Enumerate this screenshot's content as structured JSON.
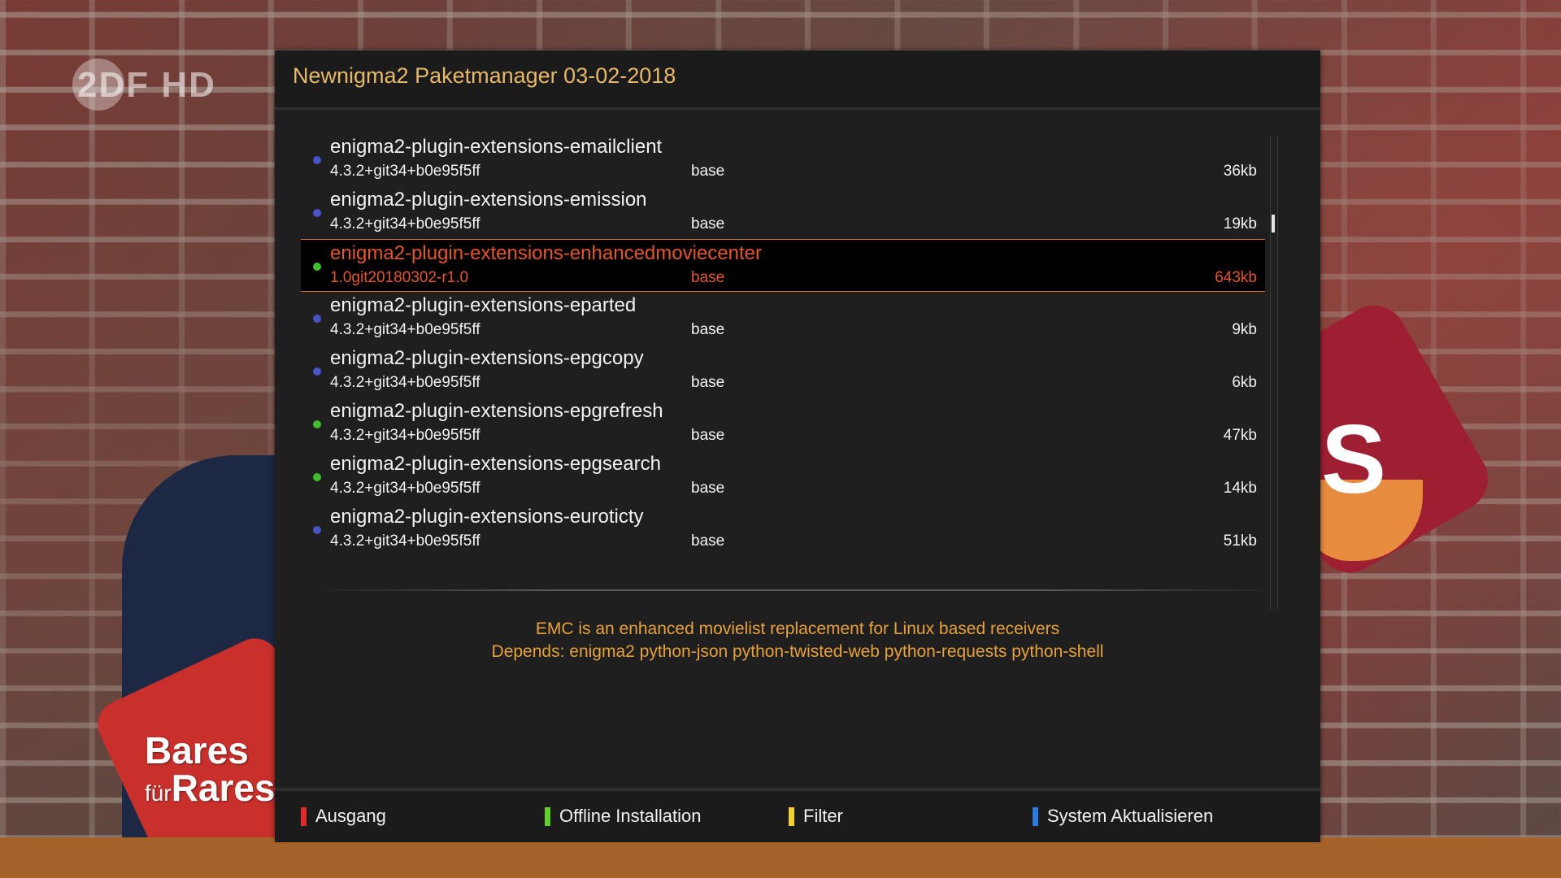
{
  "background": {
    "channel_logo": "2DF HD",
    "show_title_small": "für",
    "show_title_line1": "Bares",
    "show_title_line2": "Rares",
    "letter": "S"
  },
  "window": {
    "title": "Newnigma2 Paketmanager 03-02-2018"
  },
  "packages": [
    {
      "name": "enigma2-plugin-extensions-emailclient",
      "version": "4.3.2+git34+b0e95f5ff",
      "section": "base",
      "size": "36kb",
      "status": "blue",
      "selected": false
    },
    {
      "name": "enigma2-plugin-extensions-emission",
      "version": "4.3.2+git34+b0e95f5ff",
      "section": "base",
      "size": "19kb",
      "status": "blue",
      "selected": false
    },
    {
      "name": "enigma2-plugin-extensions-enhancedmoviecenter",
      "version": "1.0git20180302-r1.0",
      "section": "base",
      "size": "643kb",
      "status": "green",
      "selected": true
    },
    {
      "name": "enigma2-plugin-extensions-eparted",
      "version": "4.3.2+git34+b0e95f5ff",
      "section": "base",
      "size": "9kb",
      "status": "blue",
      "selected": false
    },
    {
      "name": "enigma2-plugin-extensions-epgcopy",
      "version": "4.3.2+git34+b0e95f5ff",
      "section": "base",
      "size": "6kb",
      "status": "blue",
      "selected": false
    },
    {
      "name": "enigma2-plugin-extensions-epgrefresh",
      "version": "4.3.2+git34+b0e95f5ff",
      "section": "base",
      "size": "47kb",
      "status": "green",
      "selected": false
    },
    {
      "name": "enigma2-plugin-extensions-epgsearch",
      "version": "4.3.2+git34+b0e95f5ff",
      "section": "base",
      "size": "14kb",
      "status": "green",
      "selected": false
    },
    {
      "name": "enigma2-plugin-extensions-euroticty",
      "version": "4.3.2+git34+b0e95f5ff",
      "section": "base",
      "size": "51kb",
      "status": "blue",
      "selected": false
    }
  ],
  "description": {
    "line1": "EMC is an enhanced movielist replacement for Linux based receivers",
    "line2": "Depends: enigma2 python-json python-twisted-web python-requests python-shell"
  },
  "footer": {
    "red_label": "Ausgang",
    "green_label": "Offline Installation",
    "yellow_label": "Filter",
    "blue_label": "System Aktualisieren"
  },
  "colors": {
    "status_blue": "#4a52c8",
    "status_green": "#3fbf2f",
    "key_red": "#e02a2a",
    "key_green": "#5fd02a",
    "key_yellow": "#f2d22a",
    "key_blue": "#2a7ae0",
    "selection_text": "#e2572b",
    "title": "#e8b86a",
    "description": "#e8a13a"
  }
}
